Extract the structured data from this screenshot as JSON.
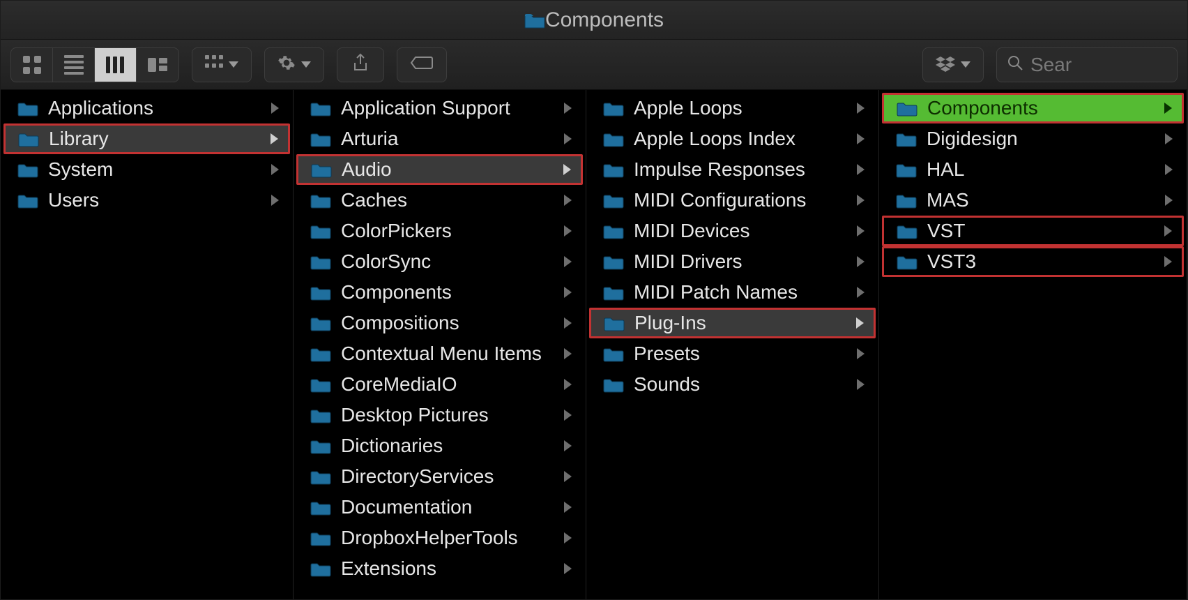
{
  "window_title": "Components",
  "search_placeholder": "Sear",
  "columns": [
    {
      "items": [
        {
          "label": "Applications",
          "has_children": true,
          "selected": false,
          "highlight": null
        },
        {
          "label": "Library",
          "has_children": true,
          "selected": true,
          "highlight": "red"
        },
        {
          "label": "System",
          "has_children": true,
          "selected": false,
          "highlight": null
        },
        {
          "label": "Users",
          "has_children": true,
          "selected": false,
          "highlight": null
        }
      ]
    },
    {
      "items": [
        {
          "label": "Application Support",
          "has_children": true,
          "selected": false,
          "highlight": null
        },
        {
          "label": "Arturia",
          "has_children": true,
          "selected": false,
          "highlight": null
        },
        {
          "label": "Audio",
          "has_children": true,
          "selected": true,
          "highlight": "red"
        },
        {
          "label": "Caches",
          "has_children": true,
          "selected": false,
          "highlight": null
        },
        {
          "label": "ColorPickers",
          "has_children": true,
          "selected": false,
          "highlight": null
        },
        {
          "label": "ColorSync",
          "has_children": true,
          "selected": false,
          "highlight": null
        },
        {
          "label": "Components",
          "has_children": true,
          "selected": false,
          "highlight": null
        },
        {
          "label": "Compositions",
          "has_children": true,
          "selected": false,
          "highlight": null
        },
        {
          "label": "Contextual Menu Items",
          "has_children": true,
          "selected": false,
          "highlight": null
        },
        {
          "label": "CoreMediaIO",
          "has_children": true,
          "selected": false,
          "highlight": null
        },
        {
          "label": "Desktop Pictures",
          "has_children": true,
          "selected": false,
          "highlight": null
        },
        {
          "label": "Dictionaries",
          "has_children": true,
          "selected": false,
          "highlight": null
        },
        {
          "label": "DirectoryServices",
          "has_children": true,
          "selected": false,
          "highlight": null
        },
        {
          "label": "Documentation",
          "has_children": true,
          "selected": false,
          "highlight": null
        },
        {
          "label": "DropboxHelperTools",
          "has_children": true,
          "selected": false,
          "highlight": null
        },
        {
          "label": "Extensions",
          "has_children": true,
          "selected": false,
          "highlight": null
        }
      ]
    },
    {
      "items": [
        {
          "label": "Apple Loops",
          "has_children": true,
          "selected": false,
          "highlight": null
        },
        {
          "label": "Apple Loops Index",
          "has_children": true,
          "selected": false,
          "highlight": null
        },
        {
          "label": "Impulse Responses",
          "has_children": true,
          "selected": false,
          "highlight": null
        },
        {
          "label": "MIDI Configurations",
          "has_children": true,
          "selected": false,
          "highlight": null
        },
        {
          "label": "MIDI Devices",
          "has_children": true,
          "selected": false,
          "highlight": null
        },
        {
          "label": "MIDI Drivers",
          "has_children": true,
          "selected": false,
          "highlight": null
        },
        {
          "label": "MIDI Patch Names",
          "has_children": true,
          "selected": false,
          "highlight": null
        },
        {
          "label": "Plug-Ins",
          "has_children": true,
          "selected": true,
          "highlight": "red"
        },
        {
          "label": "Presets",
          "has_children": true,
          "selected": false,
          "highlight": null
        },
        {
          "label": "Sounds",
          "has_children": true,
          "selected": false,
          "highlight": null
        }
      ]
    },
    {
      "items": [
        {
          "label": "Components",
          "has_children": true,
          "selected": true,
          "highlight": "green"
        },
        {
          "label": "Digidesign",
          "has_children": true,
          "selected": false,
          "highlight": null
        },
        {
          "label": "HAL",
          "has_children": true,
          "selected": false,
          "highlight": null
        },
        {
          "label": "MAS",
          "has_children": true,
          "selected": false,
          "highlight": null
        },
        {
          "label": "VST",
          "has_children": true,
          "selected": false,
          "highlight": "red"
        },
        {
          "label": "VST3",
          "has_children": true,
          "selected": false,
          "highlight": "red"
        }
      ]
    }
  ]
}
